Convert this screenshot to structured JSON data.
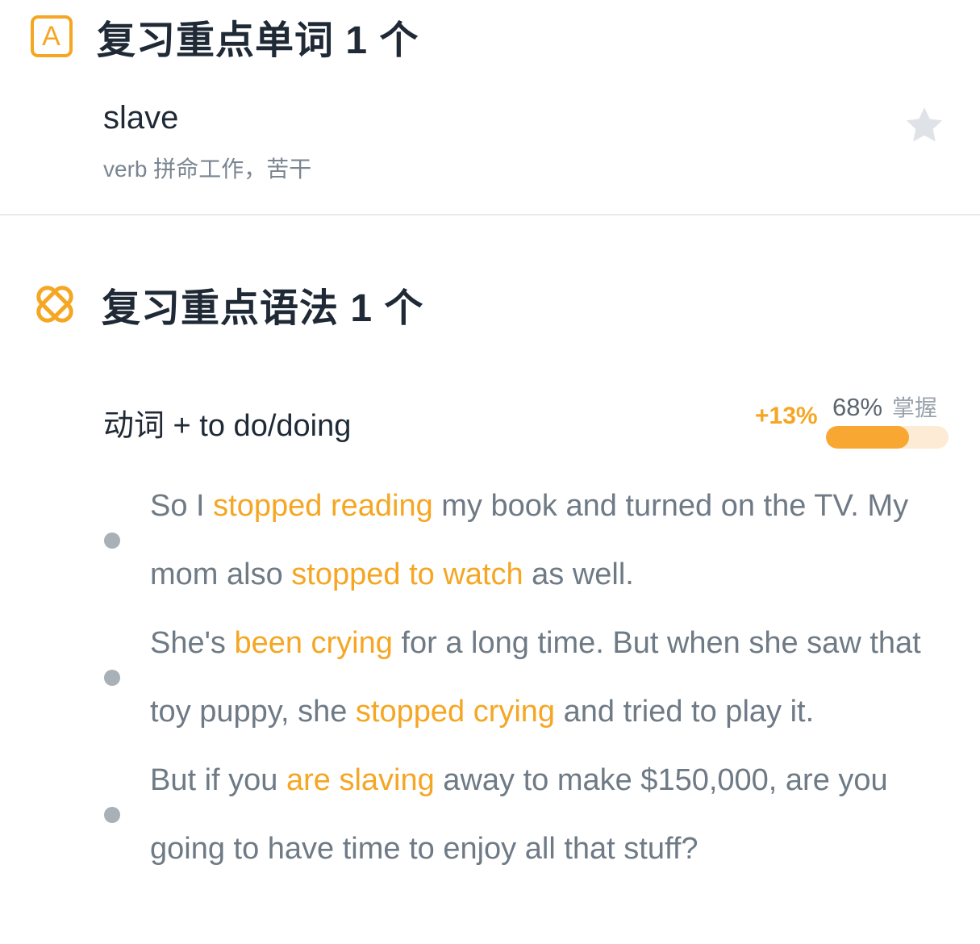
{
  "vocab": {
    "icon": "letter-a-icon",
    "title": "复习重点单词 1 个",
    "word": "slave",
    "definition": "verb 拼命工作，苦干",
    "favorite_icon": "star-icon"
  },
  "grammar": {
    "icon": "grammar-icon",
    "title": "复习重点语法 1 个",
    "item": {
      "name": "动词 + to do/doing",
      "delta": "+13%",
      "mastery_percent": "68%",
      "mastery_label": "掌握",
      "mastery_value": 0.68
    },
    "examples": [
      {
        "parts": [
          {
            "t": "So I ",
            "h": false
          },
          {
            "t": "stopped reading",
            "h": true
          },
          {
            "t": " my book and turned on the TV. My mom also ",
            "h": false
          },
          {
            "t": "stopped to watch",
            "h": true
          },
          {
            "t": " as well.",
            "h": false
          }
        ]
      },
      {
        "parts": [
          {
            "t": "She's ",
            "h": false
          },
          {
            "t": "been crying",
            "h": true
          },
          {
            "t": " for a long time. But when she saw that toy puppy, she ",
            "h": false
          },
          {
            "t": "stopped crying",
            "h": true
          },
          {
            "t": " and tried to play it.",
            "h": false
          }
        ]
      },
      {
        "parts": [
          {
            "t": "But if you ",
            "h": false
          },
          {
            "t": "are slaving",
            "h": true
          },
          {
            "t": " away to make $150,000, are you going to have time to enjoy all that stuff?",
            "h": false
          }
        ]
      }
    ]
  },
  "colors": {
    "accent": "#f5a623",
    "title_text": "#1f2a36",
    "body_text": "#6e7a85",
    "progress_track": "#fdebd6"
  }
}
